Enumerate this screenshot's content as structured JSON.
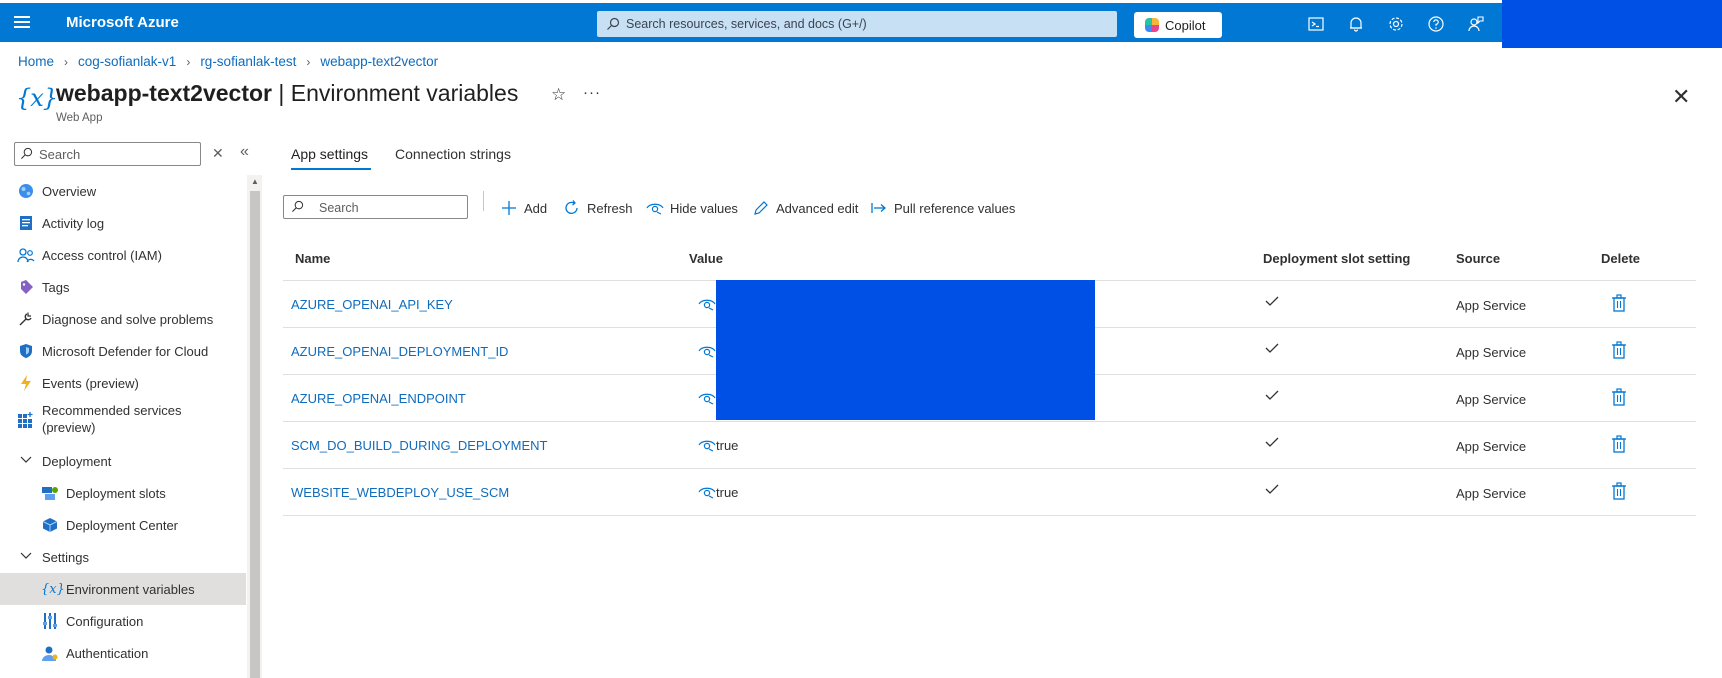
{
  "header": {
    "brand": "Microsoft Azure",
    "search_placeholder": "Search resources, services, and docs (G+/)",
    "copilot_label": "Copilot",
    "icons": [
      "terminal-icon",
      "bell-icon",
      "gear-icon",
      "help-icon",
      "feedback-icon"
    ],
    "accent_color": "#0078d4"
  },
  "breadcrumb": [
    "Home",
    "cog-sofianlak-v1",
    "rg-sofianlak-test",
    "webapp-text2vector"
  ],
  "page": {
    "title_bold": "webapp-text2vector",
    "title_rest": " | Environment variables",
    "subtitle": "Web App",
    "more_label": "···"
  },
  "sidebar": {
    "search_placeholder": "Search",
    "items": [
      {
        "label": "Overview",
        "icon": "globe-icon"
      },
      {
        "label": "Activity log",
        "icon": "log-icon"
      },
      {
        "label": "Access control (IAM)",
        "icon": "people-icon"
      },
      {
        "label": "Tags",
        "icon": "tag-icon"
      },
      {
        "label": "Diagnose and solve problems",
        "icon": "wrench-icon"
      },
      {
        "label": "Microsoft Defender for Cloud",
        "icon": "shield-icon"
      },
      {
        "label": "Events (preview)",
        "icon": "lightning-icon"
      },
      {
        "label": "Recommended services",
        "label2": "(preview)",
        "icon": "grid-plus-icon"
      },
      {
        "label": "Deployment",
        "icon": "chevron-down-icon"
      },
      {
        "label": "Deployment slots",
        "icon": "slots-icon"
      },
      {
        "label": "Deployment Center",
        "icon": "cube-icon"
      },
      {
        "label": "Settings",
        "icon": "chevron-down-icon"
      },
      {
        "label": "Environment variables",
        "icon": "variable-icon"
      },
      {
        "label": "Configuration",
        "icon": "sliders-icon"
      },
      {
        "label": "Authentication",
        "icon": "person-key-icon"
      }
    ]
  },
  "tabs": [
    {
      "label": "App settings",
      "active": true
    },
    {
      "label": "Connection strings",
      "active": false
    }
  ],
  "toolbar": {
    "search_placeholder": "Search",
    "add": "Add",
    "refresh": "Refresh",
    "hide_values": "Hide values",
    "advanced_edit": "Advanced edit",
    "pull_reference": "Pull reference values"
  },
  "table": {
    "columns": [
      "Name",
      "Value",
      "Deployment slot setting",
      "Source",
      "Delete"
    ],
    "rows": [
      {
        "name": "AZURE_OPENAI_API_KEY",
        "value": "",
        "slot_setting": true,
        "source": "App Service"
      },
      {
        "name": "AZURE_OPENAI_DEPLOYMENT_ID",
        "value": "",
        "slot_setting": true,
        "source": "App Service"
      },
      {
        "name": "AZURE_OPENAI_ENDPOINT",
        "value": "",
        "slot_setting": true,
        "source": "App Service"
      },
      {
        "name": "SCM_DO_BUILD_DURING_DEPLOYMENT",
        "value": "true",
        "slot_setting": true,
        "source": "App Service"
      },
      {
        "name": "WEBSITE_WEBDEPLOY_USE_SCM",
        "value": "true",
        "slot_setting": true,
        "source": "App Service"
      }
    ]
  }
}
